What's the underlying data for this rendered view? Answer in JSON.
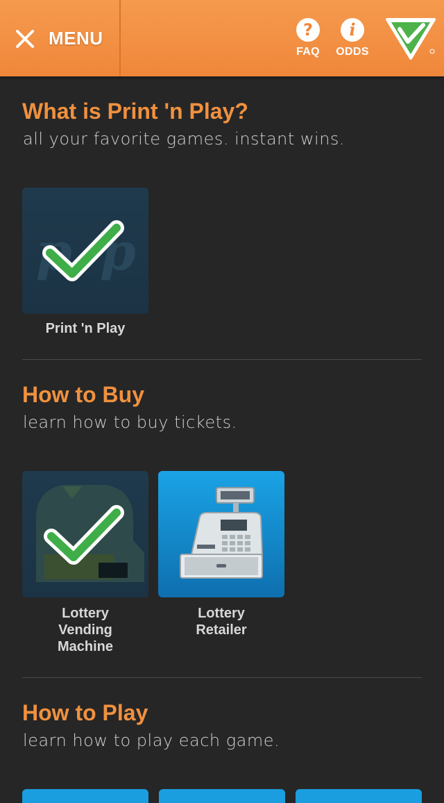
{
  "header": {
    "menu_label": "MENU",
    "faq_label": "FAQ",
    "odds_label": "ODDS",
    "faq_icon_glyph": "?",
    "odds_icon_glyph": "i",
    "accent_color": "#f0873a"
  },
  "sections": [
    {
      "title": "What is Print 'n Play?",
      "subtitle": "all your favorite games. instant wins.",
      "tiles": [
        {
          "label": "Print 'n Play",
          "icon": "print-n-play-logo-icon",
          "checked": true
        }
      ]
    },
    {
      "title": "How to Buy",
      "subtitle": "learn how to buy tickets.",
      "tiles": [
        {
          "label": "Lottery\nVending\nMachine",
          "icon": "vending-machine-icon",
          "checked": true
        },
        {
          "label": "Lottery\nRetailer",
          "icon": "cash-register-icon",
          "checked": false
        }
      ]
    },
    {
      "title": "How to Play",
      "subtitle": "learn how to play each game.",
      "tiles": []
    }
  ],
  "colors": {
    "background": "#262626",
    "section_title": "#f0913f",
    "tile_active": "#1a9ee0",
    "tile_dim": "#1f3a4d",
    "checkmark_green": "#3fae49"
  }
}
